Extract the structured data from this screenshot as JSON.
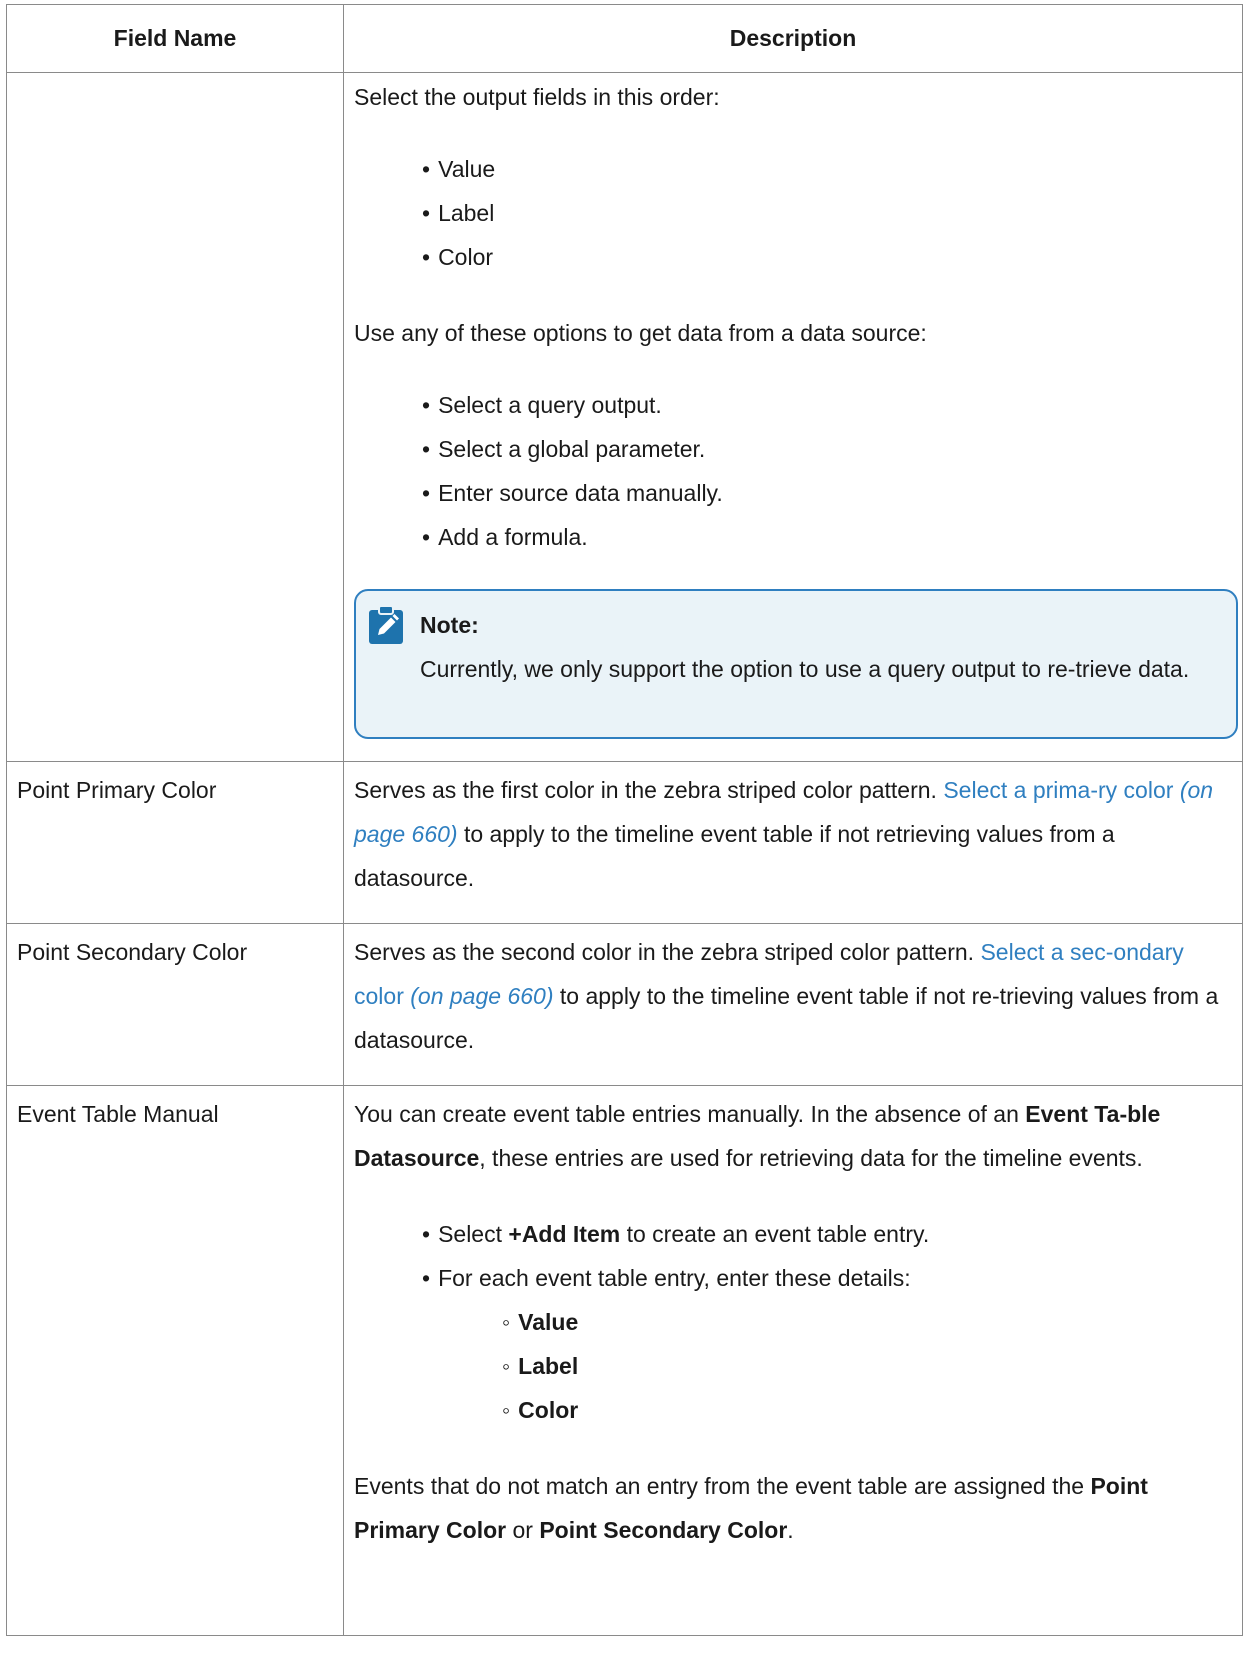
{
  "table": {
    "headers": [
      "Field Name",
      "Description"
    ],
    "row1": {
      "field": "",
      "intro": "Select the output fields in this order:",
      "fields": [
        "Value",
        "Label",
        "Color"
      ],
      "options_intro": "Use any of these options to get data from a data source:",
      "options": [
        "Select a query output.",
        "Select a global parameter.",
        "Enter source data manually.",
        "Add a formula."
      ],
      "note": {
        "title": "Note:",
        "text": "Currently, we only support the option to use a query output to re-trieve data."
      }
    },
    "row2": {
      "field": "Point Primary Color",
      "pre": "Serves as the first color in the zebra striped color pattern. ",
      "link": "Select a prima-ry color",
      "link_ref": "(on page 660)",
      "post": " to apply to the timeline event table if not retrieving values from a datasource."
    },
    "row3": {
      "field": "Point Secondary Color",
      "pre": "Serves as the second color in the zebra striped color pattern. ",
      "link": "Select a sec-ondary color",
      "link_ref": "(on page 660)",
      "post": " to apply to the timeline event table if not re-trieving values from a datasource."
    },
    "row4": {
      "field": "Event Table Manual",
      "p1_a": "You can create event table entries manually. In the absence of an ",
      "p1_b": "Event Ta-ble Datasource",
      "p1_c": ", these entries are used for retrieving data for the timeline events.",
      "step1_a": "Select ",
      "step1_b": "+Add Item",
      "step1_c": " to create an event table entry.",
      "step2": "For each event table entry, enter these details:",
      "details": [
        "Value",
        "Label",
        "Color"
      ],
      "p2_a": "Events that do not match an entry from the event table are assigned the ",
      "p2_b": "Point Primary Color",
      "p2_c": " or ",
      "p2_d": "Point Secondary Color",
      "p2_e": "."
    }
  },
  "colors": {
    "link": "#2f7fc0",
    "note_bg": "#eaf3f8",
    "note_border": "#2f7fc0",
    "border": "#8a8a8a"
  },
  "icons": {
    "note": "pencil-clipboard-icon"
  }
}
